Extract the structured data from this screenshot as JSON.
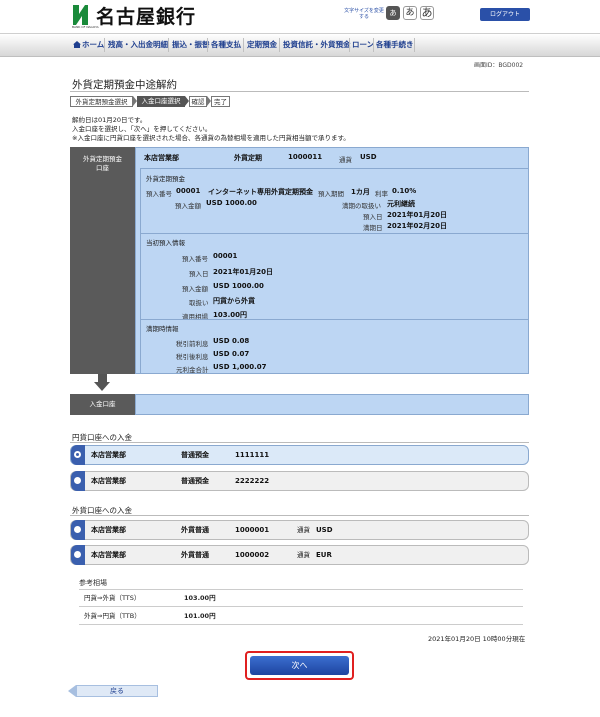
{
  "header": {
    "bank_name": "名古屋銀行",
    "bank_name_en": "BANK OF NAGOYA",
    "fontsize_label": "文字サイズを変更する",
    "fontsize_buttons": [
      "あ",
      "あ",
      "あ"
    ],
    "logout": "ログアウト",
    "brand_color": "#1a8a3a",
    "accent_color": "#2a50a8"
  },
  "nav": {
    "home": "ホーム",
    "items": [
      "残高・入出金明細",
      "振込・振替",
      "各種支払",
      "定期預金",
      "投資信託・外貨預金",
      "ローン",
      "各種手続き"
    ]
  },
  "screen_id": "画面ID：BGD002",
  "page_title": "外貨定期預金中途解約",
  "steps": [
    "外貨定期預金選択",
    "入金口座選択",
    "確認",
    "完了"
  ],
  "current_step": 2,
  "intro": [
    "解約日は01月20日です。",
    "入金口座を選択し、「次へ」を押してください。",
    "※入金口座に円貨口座を選択された場合、各通貨の為替相場を適用した円貨相当額で承ります。"
  ],
  "account": {
    "side_label_1": "外貨定期預金",
    "side_label_2": "口座",
    "branch": "本店営業部",
    "type": "外貨定期",
    "number": "1000011",
    "currency_label": "通貨",
    "currency": "USD",
    "deposit_section": "外貨定期預金",
    "deposit_no_label": "預入番号",
    "deposit_no": "00001",
    "product": "インターネット専用外貨定期預金",
    "period_label": "預入期間",
    "period": "1カ月",
    "rate_label": "利率",
    "rate": "0.10%",
    "amount_label": "預入金額",
    "amount": "USD 1000.00",
    "maturity_handling_label": "満期の取扱い",
    "maturity_handling": "元利継続",
    "deposit_date_label": "預入日",
    "deposit_date": "2021年01月20日",
    "maturity_date_label": "満期日",
    "maturity_date": "2021年02月20日",
    "initial_section": "当初預入情報",
    "initial_no_label": "預入番号",
    "initial_no": "00001",
    "initial_date_label": "預入日",
    "initial_date": "2021年01月20日",
    "initial_amount_label": "預入金額",
    "initial_amount": "USD 1000.00",
    "method_label": "取扱い",
    "method": "円貨から外貨",
    "fx_rate_label": "適用相場",
    "fx_rate": "103.00円",
    "maturity_section": "満期時情報",
    "pre_tax_label": "税引前利息",
    "pre_tax": "USD 0.08",
    "post_tax_label": "税引後利息",
    "post_tax": "USD 0.07",
    "total_label": "元利金合計",
    "total": "USD 1,000.07"
  },
  "deposit_account_label": "入金口座",
  "yen_section": "円貨口座への入金",
  "yen_accounts": [
    {
      "branch": "本店営業部",
      "type": "普通預金",
      "number": "1111111",
      "selected": true
    },
    {
      "branch": "本店営業部",
      "type": "普通預金",
      "number": "2222222",
      "selected": false
    }
  ],
  "fx_section": "外貨口座への入金",
  "fx_accounts": [
    {
      "branch": "本店営業部",
      "type": "外貨普通",
      "number": "1000001",
      "currency_label": "通貨",
      "currency": "USD",
      "selected": false
    },
    {
      "branch": "本店営業部",
      "type": "外貨普通",
      "number": "1000002",
      "currency_label": "通貨",
      "currency": "EUR",
      "selected": false
    }
  ],
  "reference": {
    "title": "参考相場",
    "rows": [
      {
        "label": "円貨⇒外貨（TTS）",
        "value": "103.00円"
      },
      {
        "label": "外貨⇒円貨（TTB）",
        "value": "101.00円"
      }
    ]
  },
  "timestamp": "2021年01月20日 10時00分現在",
  "next_button": "次へ",
  "back_button": "戻る"
}
